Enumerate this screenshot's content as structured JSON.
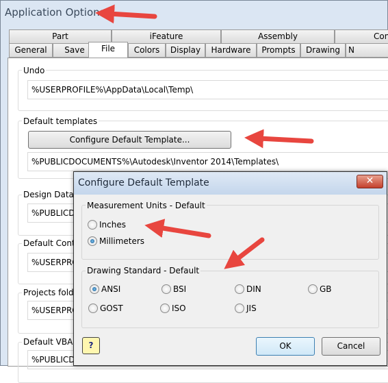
{
  "window": {
    "title": "Application Options"
  },
  "tabs_row1": [
    "Part",
    "iFeature",
    "Assembly",
    "Cont"
  ],
  "tabs_row2": [
    "General",
    "Save",
    "File",
    "Colors",
    "Display",
    "Hardware",
    "Prompts",
    "Drawing",
    "N"
  ],
  "active_tab": "File",
  "file": {
    "undo": {
      "label": "Undo",
      "value": "%USERPROFILE%\\AppData\\Local\\Temp\\"
    },
    "templates": {
      "label": "Default templates",
      "button": "Configure Default Template...",
      "value": "%PUBLICDOCUMENTS%\\Autodesk\\Inventor 2014\\Templates\\"
    },
    "design_data": {
      "label": "Design Data (",
      "value": "%PUBLICDO"
    },
    "default_content": {
      "label": "Default Conte",
      "value": "%USERPRO"
    },
    "projects": {
      "label": "Projects folde",
      "value": "%USERPRO"
    },
    "vba": {
      "label": "Default VBA p",
      "value": "%PUBLICDO"
    }
  },
  "dialog": {
    "title": "Configure Default Template",
    "close_icon": "close-icon",
    "units": {
      "legend": "Measurement Units - Default",
      "options": [
        "Inches",
        "Millimeters"
      ],
      "selected": "Millimeters"
    },
    "standard": {
      "legend": "Drawing Standard - Default",
      "options": [
        "ANSI",
        "BSI",
        "DIN",
        "GB",
        "GOST",
        "ISO",
        "JIS"
      ],
      "selected": "ANSI"
    },
    "help_icon": "help-icon",
    "ok": "OK",
    "cancel": "Cancel"
  },
  "annotation_color": "#e8463f"
}
